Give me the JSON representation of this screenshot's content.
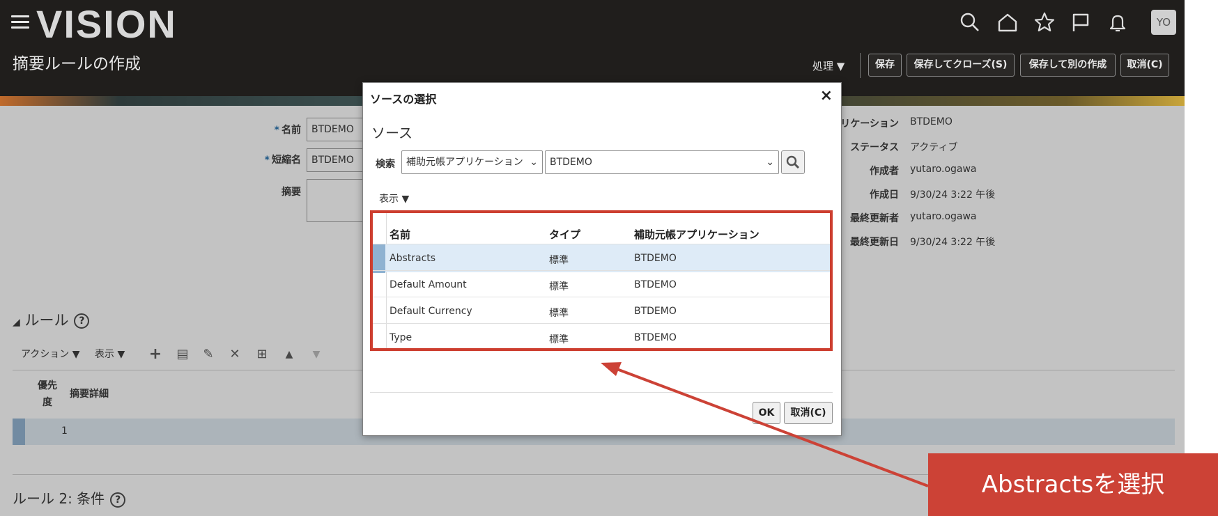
{
  "header": {
    "logo": "VISION",
    "page_title": "摘要ルールの作成",
    "avatar": "YO",
    "process_menu": "処理",
    "buttons": {
      "save": "保存",
      "save_close": "保存してクローズ(S)",
      "save_new": "保存して別の作成",
      "cancel": "取消(C)"
    }
  },
  "form": {
    "name_label": "名前",
    "name_value": "BTDEMO",
    "short_label": "短縮名",
    "short_value": "BTDEMO",
    "summary_label": "摘要",
    "right": [
      {
        "label": "リケーション",
        "value": "BTDEMO"
      },
      {
        "label": "ステータス",
        "value": "アクティブ"
      },
      {
        "label": "作成者",
        "value": "yutaro.ogawa"
      },
      {
        "label": "作成日",
        "value": "9/30/24 3:22 午後"
      },
      {
        "label": "最終更新者",
        "value": "yutaro.ogawa"
      },
      {
        "label": "最終更新日",
        "value": "9/30/24 3:22 午後"
      }
    ]
  },
  "rules": {
    "title": "ルール",
    "action_menu": "アクション",
    "view_menu": "表示",
    "col_priority": "優先度",
    "col_detail": "摘要詳細",
    "row_priority": "1",
    "rule2_title": "ルール 2: 条件"
  },
  "dialog": {
    "title": "ソースの選択",
    "section": "ソース",
    "search_label": "検索",
    "field_select": "補助元帳アプリケーション",
    "search_value": "BTDEMO",
    "view_menu": "表示",
    "columns": {
      "name": "名前",
      "type": "タイプ",
      "app": "補助元帳アプリケーション"
    },
    "rows": [
      {
        "name": "Abstracts",
        "type": "標準",
        "app": "BTDEMO"
      },
      {
        "name": "Default Amount",
        "type": "標準",
        "app": "BTDEMO"
      },
      {
        "name": "Default Currency",
        "type": "標準",
        "app": "BTDEMO"
      },
      {
        "name": "Type",
        "type": "標準",
        "app": "BTDEMO"
      }
    ],
    "ok_label": "OK",
    "cancel_label": "取消(C)"
  },
  "annotation": {
    "callout": "Abstractsを選択",
    "color": "#cc4236"
  }
}
